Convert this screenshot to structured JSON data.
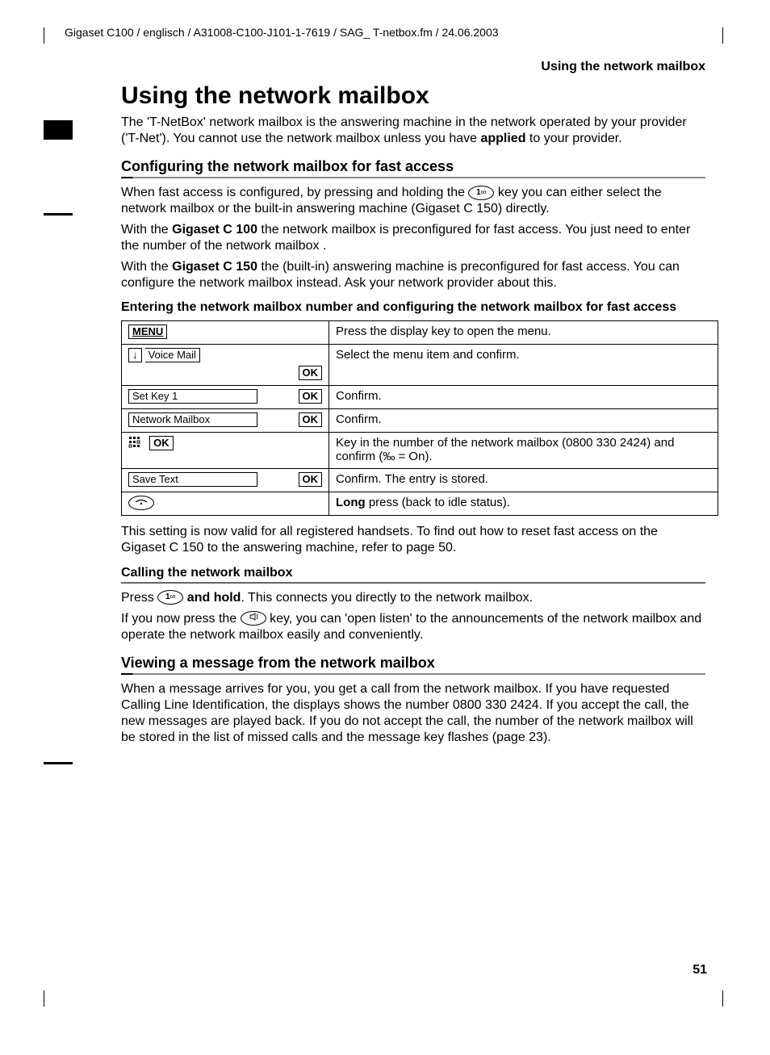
{
  "header": {
    "trail": "Gigaset C100 / englisch / A31008-C100-J101-1-7619 / SAG_ T-netbox.fm / 24.06.2003",
    "running": "Using the network mailbox"
  },
  "title": "Using the network mailbox",
  "intro": {
    "p1a": "The 'T-NetBox' network mailbox is the answering machine in the network operated by your provider ('T-Net'). You cannot use the network mailbox unless you have ",
    "p1b": "applied",
    "p1c": " to your provider."
  },
  "sec1": {
    "heading": "Configuring the network mailbox for fast access",
    "p1a": "When fast access is configured, by pressing and holding the ",
    "p1b": " key you can either select the network mailbox or the built-in answering machine (Gigaset C 150) directly.",
    "p2a": "With the ",
    "p2b": "Gigaset C 100",
    "p2c": " the network mailbox is preconfigured for fast access. You just need to enter the number of the network mailbox .",
    "p3a": "With the ",
    "p3b": "Gigaset C 150",
    "p3c": " the (built-in) answering machine is preconfigured for fast access. You can configure the network mailbox instead. Ask your network provider about this.",
    "subhead": "Entering the network mailbox number and configuring the network mailbox for fast access",
    "table": [
      {
        "left_type": "menu",
        "right": "Press the display key to open the menu."
      },
      {
        "left_type": "voicemail",
        "menu_item": "Voice Mail",
        "right": "Select the menu item and confirm."
      },
      {
        "left_type": "label_ok",
        "label": "Set Key 1",
        "right": "Confirm."
      },
      {
        "left_type": "label_ok",
        "label": "Network Mailbox",
        "right": "Confirm."
      },
      {
        "left_type": "keypad_ok",
        "right": "Key in the number of the network mailbox (0800 330 2424) and confirm (‰ = On)."
      },
      {
        "left_type": "label_ok",
        "label": "Save Text",
        "right": "Confirm. The entry is stored."
      },
      {
        "left_type": "hangup",
        "right_bold": "Long",
        "right_rest": " press (back to idle status)."
      }
    ],
    "after": "This setting is now valid for all registered handsets. To find out how to reset fast access on the Gigaset C 150 to the answering machine, refer to page 50."
  },
  "sec2": {
    "heading": "Calling the network mailbox",
    "p1a": "Press ",
    "p1b": " and hold",
    "p1c": ". This connects you directly to the network mailbox.",
    "p2a": "If you now press the ",
    "p2b": " key, you can 'open listen' to the announcements of the network mailbox and operate the network mailbox easily and conveniently."
  },
  "sec3": {
    "heading": "Viewing a message from the network mailbox",
    "p1": "When a message arrives for you, you get a call from the network mailbox. If you have requested Calling Line Identification, the displays shows the number 0800 330 2424. If you accept the call, the new messages are played back. If you do not accept the call, the number of the network mailbox will be stored in the list of  missed calls and the message key flashes (page 23)."
  },
  "labels": {
    "menu": "MENU",
    "ok": "OK",
    "key1": "1",
    "arrow_down": "↓"
  },
  "page_number": "51"
}
